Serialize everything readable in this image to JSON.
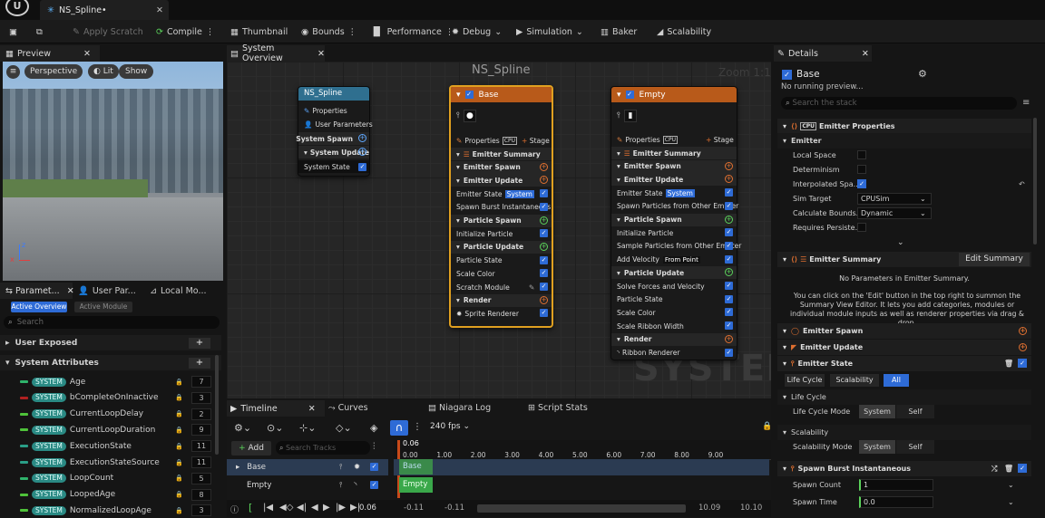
{
  "app": {
    "tab_title": "NS_Spline•"
  },
  "toolbar": {
    "apply_scratch": "Apply Scratch",
    "compile": "Compile",
    "thumbnail": "Thumbnail",
    "bounds": "Bounds",
    "performance": "Performance",
    "debug": "Debug",
    "simulation": "Simulation",
    "baker": "Baker",
    "scalability": "Scalability"
  },
  "preview": {
    "title": "Preview",
    "perspective": "Perspective",
    "lit": "Lit",
    "show": "Show"
  },
  "params": {
    "tabs": [
      "Paramet...",
      "User Par...",
      "Local Mo..."
    ],
    "sub_tabs": [
      "Active Overview",
      "Active Module"
    ],
    "search_placeholder": "Search",
    "user_exposed": "User Exposed",
    "system_attributes": "System Attributes",
    "badge": "SYSTEM",
    "items": [
      {
        "name": "Age",
        "count": "7",
        "color": "#2fb36b"
      },
      {
        "name": "bCompleteOnInactive",
        "count": "3",
        "color": "#b02020"
      },
      {
        "name": "CurrentLoopDelay",
        "count": "2",
        "color": "#4fc23a"
      },
      {
        "name": "CurrentLoopDuration",
        "count": "9",
        "color": "#4fc23a"
      },
      {
        "name": "ExecutionState",
        "count": "11",
        "color": "#2a9e86"
      },
      {
        "name": "ExecutionStateSource",
        "count": "11",
        "color": "#2a9e86"
      },
      {
        "name": "LoopCount",
        "count": "5",
        "color": "#2fb36b"
      },
      {
        "name": "LoopedAge",
        "count": "8",
        "color": "#4fc23a"
      },
      {
        "name": "NormalizedLoopAge",
        "count": "3",
        "color": "#4fc23a"
      }
    ]
  },
  "graph": {
    "tab": "System Overview",
    "title": "NS_Spline",
    "zoom": "Zoom 1:1",
    "watermark": "SYSTEM",
    "system_node": {
      "title": "NS_Spline",
      "rows": [
        "Properties",
        "User Parameters",
        "System Spawn",
        "System Update",
        "System State"
      ]
    },
    "base_node": {
      "title": "Base",
      "properties": "Properties",
      "stage": "Stage",
      "rows": [
        "Emitter Summary",
        "Emitter Spawn",
        "Emitter Update",
        "Emitter State",
        "Spawn Burst Instantaneous",
        "Particle Spawn",
        "Initialize Particle",
        "Particle Update",
        "Particle State",
        "Scale Color",
        "Scratch Module",
        "Render",
        "Sprite Renderer"
      ],
      "system_tag": "System"
    },
    "empty_node": {
      "title": "Empty",
      "properties": "Properties",
      "stage": "Stage",
      "rows": [
        "Emitter Summary",
        "Emitter Spawn",
        "Emitter Update",
        "Emitter State",
        "Spawn Particles from Other Emitter",
        "Particle Spawn",
        "Initialize Particle",
        "Sample Particles from Other Emitter",
        "Add Velocity",
        "Particle Update",
        "Solve Forces and Velocity",
        "Particle State",
        "Scale Color",
        "Scale Ribbon Width",
        "Render",
        "Ribbon Renderer"
      ],
      "system_tag": "System",
      "from_point": "From Point"
    }
  },
  "timeline": {
    "tabs": [
      "Timeline",
      "Curves",
      "Niagara Log",
      "Script Stats"
    ],
    "fps": "240 fps",
    "add": "Add",
    "search_placeholder": "Search Tracks",
    "tracks": [
      "Base",
      "Empty"
    ],
    "playhead": "0.06",
    "ticks": [
      "0.00",
      "1.00",
      "2.00",
      "3.00",
      "4.00",
      "5.00",
      "6.00",
      "7.00",
      "8.00",
      "9.00"
    ],
    "time_current": "0.06",
    "range_start": "-0.11",
    "range_start2": "-0.11",
    "range_end": "10.09",
    "range_end2": "10.10"
  },
  "details": {
    "title": "Details",
    "object": "Base",
    "status": "No running preview...",
    "search_placeholder": "Search the stack",
    "emitter_properties": "Emitter Properties",
    "emitter": "Emitter",
    "local_space": "Local Space",
    "determinism": "Determinism",
    "interpolated": "Interpolated Spa...",
    "sim_target": "Sim Target",
    "sim_target_value": "CPUSim",
    "calc_bounds": "Calculate Bounds...",
    "calc_bounds_value": "Dynamic",
    "requires_persist": "Requires Persiste...",
    "emitter_summary": "Emitter Summary",
    "edit_summary": "Edit Summary",
    "no_params": "No Parameters in Emitter Summary.",
    "help": "You can click on the 'Edit' button in the top right to summon the Summary View Editor. It lets you add categories, modules or individual module inputs as well as renderer properties via drag & drop.",
    "emitter_spawn": "Emitter Spawn",
    "emitter_update": "Emitter Update",
    "emitter_state": "Emitter State",
    "tab_lifecycle": "Life Cycle",
    "tab_scalability": "Scalability",
    "tab_all": "All",
    "life_cycle": "Life Cycle",
    "life_cycle_mode": "Life Cycle Mode",
    "system": "System",
    "self": "Self",
    "scalability": "Scalability",
    "scalability_mode": "Scalability Mode",
    "spawn_burst": "Spawn Burst Instantaneous",
    "spawn_count": "Spawn Count",
    "spawn_count_value": "1",
    "spawn_time": "Spawn Time",
    "spawn_time_value": "0.0"
  },
  "colors": {
    "accent": "#2e6bd6",
    "base_border": "#e0a020",
    "emitter_header": "#b85a1a",
    "system_header": "#2f6f8f"
  }
}
